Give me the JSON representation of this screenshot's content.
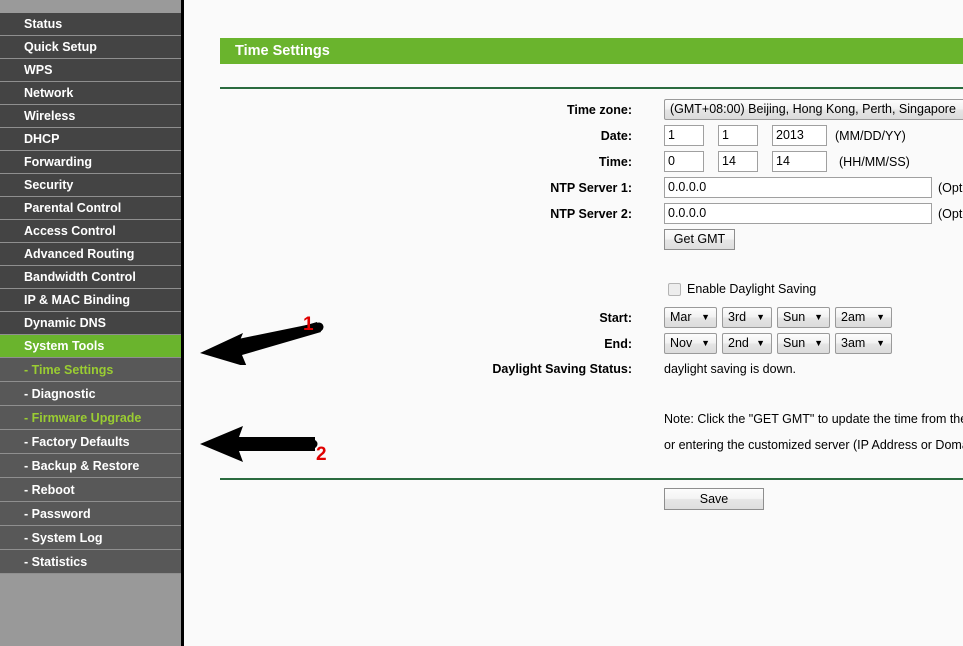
{
  "sidebar": {
    "items": [
      {
        "label": "Status",
        "selected": false
      },
      {
        "label": "Quick Setup",
        "selected": false
      },
      {
        "label": "WPS",
        "selected": false
      },
      {
        "label": "Network",
        "selected": false
      },
      {
        "label": "Wireless",
        "selected": false
      },
      {
        "label": "DHCP",
        "selected": false
      },
      {
        "label": "Forwarding",
        "selected": false
      },
      {
        "label": "Security",
        "selected": false
      },
      {
        "label": "Parental Control",
        "selected": false
      },
      {
        "label": "Access Control",
        "selected": false
      },
      {
        "label": "Advanced Routing",
        "selected": false
      },
      {
        "label": "Bandwidth Control",
        "selected": false
      },
      {
        "label": "IP & MAC Binding",
        "selected": false
      },
      {
        "label": "Dynamic DNS",
        "selected": false
      },
      {
        "label": "System Tools",
        "selected": true
      }
    ],
    "subitems": [
      {
        "label": "- Time Settings",
        "active": true
      },
      {
        "label": "- Diagnostic",
        "active": false
      },
      {
        "label": "- Firmware Upgrade",
        "active": true
      },
      {
        "label": "- Factory Defaults",
        "active": false
      },
      {
        "label": "- Backup & Restore",
        "active": false
      },
      {
        "label": "- Reboot",
        "active": false
      },
      {
        "label": "- Password",
        "active": false
      },
      {
        "label": "- System Log",
        "active": false
      },
      {
        "label": "- Statistics",
        "active": false
      }
    ]
  },
  "page": {
    "title": "Time Settings"
  },
  "form": {
    "timezone_label": "Time zone:",
    "timezone_value": "(GMT+08:00) Beijing, Hong Kong, Perth, Singapore",
    "date_label": "Date:",
    "date_month": "1",
    "date_day": "1",
    "date_year": "2013",
    "date_format": "(MM/DD/YY)",
    "time_label": "Time:",
    "time_hour": "0",
    "time_minute": "14",
    "time_second": "14",
    "time_format": "(HH/MM/SS)",
    "ntp1_label": "NTP Server 1:",
    "ntp1_value": "0.0.0.0",
    "ntp1_optional": "(Optional)",
    "ntp2_label": "NTP Server 2:",
    "ntp2_value": "0.0.0.0",
    "ntp2_optional": "(Optional)",
    "get_gmt_label": "Get GMT"
  },
  "daylight": {
    "enable_label": "Enable Daylight Saving",
    "enabled": false,
    "start_label": "Start:",
    "start_month": "Mar",
    "start_week": "3rd",
    "start_day": "Sun",
    "start_hour": "2am",
    "end_label": "End:",
    "end_month": "Nov",
    "end_week": "2nd",
    "end_day": "Sun",
    "end_hour": "3am",
    "status_label": "Daylight Saving Status:",
    "status_value": "daylight saving is down."
  },
  "note": {
    "line1": "Note: Click the \"GET GMT\" to update the time from the internet with the pre-defined servers",
    "line2": "or entering the customized server (IP Address or Domain Name) in the above frames."
  },
  "actions": {
    "save_label": "Save"
  },
  "annotations": [
    {
      "number": "1"
    },
    {
      "number": "2"
    }
  ],
  "colors": {
    "accent_green": "#6ab42d",
    "divider_green": "#2a6b3f",
    "sidebar_dark": "#444444",
    "sidebar_sub": "#585858",
    "sidebar_bg": "#999999",
    "annotation_red": "#e00000"
  }
}
